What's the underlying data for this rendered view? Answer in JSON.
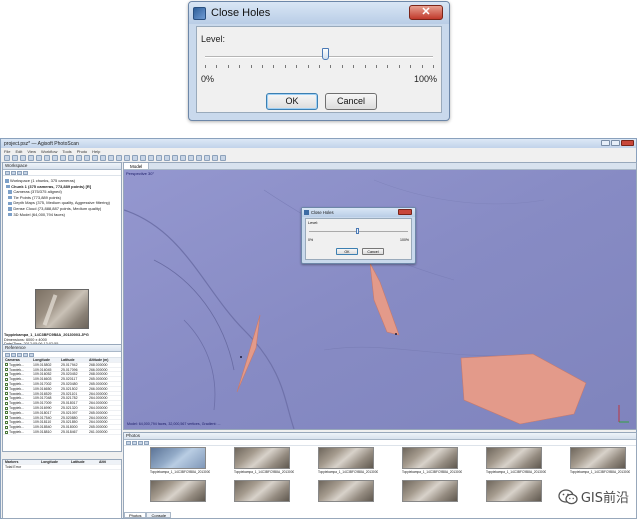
{
  "dialog": {
    "title": "Close Holes",
    "level_label": "Level:",
    "min_label": "0%",
    "max_label": "100%",
    "level_value_fraction": 0.52,
    "ok_label": "OK",
    "cancel_label": "Cancel"
  },
  "app": {
    "title": "project.psz* — Agisoft PhotoScan",
    "menu": [
      "File",
      "Edit",
      "View",
      "Workflow",
      "Tools",
      "Photo",
      "Help"
    ],
    "workspace": {
      "panel_title": "Workspace",
      "items": [
        "Workspace (1 chunks, 375 cameras)",
        "Chunk 1 (375 cameras, 773,889 points) [R]",
        "Cameras (375/375 aligned)",
        "Tie Points (773,889 points)",
        "Depth Maps (375, Medium quality, Aggressive filtering)",
        "Dense Cloud (73,888,887 points, Medium quality)",
        "3D Model (64,000,794 faces)"
      ],
      "thumb_info": [
        "Toppiekampa_1_14C3BFC9B8A_20130003.JPG",
        "Dimensions: 6000 x 4000",
        "Date/Time: 2012:05:06 13:02:55"
      ]
    },
    "reference": {
      "panel_title": "Reference",
      "columns": [
        "Cameras",
        "Longitude",
        "Latitude",
        "Altitude (m)"
      ],
      "rows": [
        [
          "Toppiek...",
          "109.015802",
          "25.017942",
          "268.000000"
        ],
        [
          "Toppiek...",
          "109.016045",
          "25.017096",
          "266.000000"
        ],
        [
          "Toppiek...",
          "109.016052",
          "25.020452",
          "268.000000"
        ],
        [
          "Toppiek...",
          "109.016603",
          "25.020117",
          "265.000000"
        ],
        [
          "Toppiek...",
          "109.017002",
          "25.020480",
          "265.000000"
        ],
        [
          "Toppiek...",
          "109.016650",
          "25.021502",
          "266.000000"
        ],
        [
          "Toppiek...",
          "109.016529",
          "25.021101",
          "264.000000"
        ],
        [
          "Toppiek...",
          "109.017048",
          "25.021782",
          "264.000000"
        ],
        [
          "Toppiek...",
          "109.017009",
          "25.018017",
          "264.000000"
        ],
        [
          "Toppiek...",
          "109.016990",
          "25.021320",
          "264.000000"
        ],
        [
          "Toppiek...",
          "109.018017",
          "25.021097",
          "265.000000"
        ],
        [
          "Toppiek...",
          "109.017540",
          "25.020880",
          "264.000000"
        ],
        [
          "Toppiek...",
          "109.018110",
          "25.021850",
          "264.000000"
        ],
        [
          "Toppiek...",
          "109.018540",
          "25.018000",
          "265.000000"
        ],
        [
          "Toppiek...",
          "109.018810",
          "25.018467",
          "261.000000"
        ]
      ],
      "marker_columns": [
        "Markers",
        "Longitude",
        "Latitude",
        "Altit"
      ],
      "marker_rows": [
        "Total Error"
      ]
    },
    "model": {
      "tab": "Model",
      "perspective": "Perspective 30°",
      "status": "Model: 64,000,794 faces, 32,000,567 vertices, Gradient: ... "
    },
    "small_dialog": {
      "title": "Close Holes",
      "level_label": "Level:",
      "min_label": "0%",
      "max_label": "100%",
      "ok_label": "OK",
      "cancel_label": "Cancel"
    },
    "photos": {
      "panel_title": "Photos",
      "captions": [
        "Toppiekampa_1_14C3BFC9B8A_20130003.JPG",
        "Toppiekampa_1_14C3BFC9B8A_20130004.JPG",
        "Toppiekampa_1_14C3BFC9B8A_20130005.JPG",
        "Toppiekampa_1_14C3BFC9B8A_20130006.JPG",
        "Toppiekampa_1_14C3BFC9B8A_20130007.JPG",
        "Toppiekampa_1_14C3BFC9B8A_20130008.JPG"
      ],
      "tabs": [
        "Photos",
        "Console"
      ]
    }
  },
  "watermark": {
    "text": "GIS前沿",
    "icon": "wechat-icon"
  },
  "colors": {
    "model_bg": "#8d91c8",
    "hole_fill": "#e39a8a",
    "dialog_frame": "#c9d9ec"
  }
}
